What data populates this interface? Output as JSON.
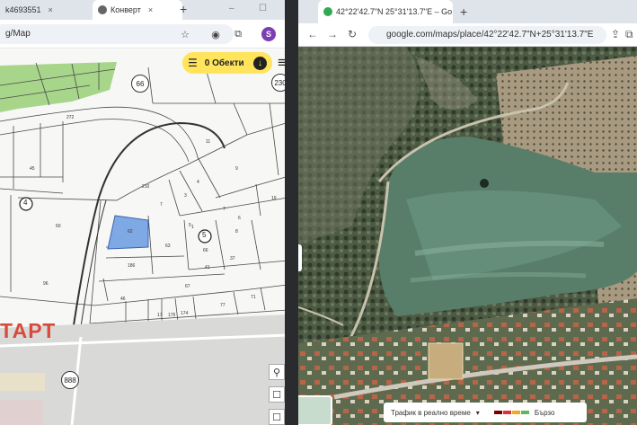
{
  "left_window": {
    "tabs": [
      {
        "label": "k4693551",
        "close": "×"
      },
      {
        "label": "Конверт",
        "close": "×"
      }
    ],
    "new_tab": "+",
    "window_controls": [
      "–",
      "☐"
    ],
    "address": "g/Map",
    "toolbar_icons": [
      "star-icon",
      "shield-icon",
      "extension-icon",
      "profile-avatar",
      "menu-icon"
    ],
    "profile_letter": "S",
    "objects_button_label": "0 Обекти",
    "map_labels": {
      "start_partial": "ТАРТ",
      "road_badges": [
        "66",
        "230",
        "888"
      ],
      "circled_parcels": [
        "4",
        "5"
      ],
      "parcel_numbers": [
        "272",
        "45",
        "210",
        "7",
        "3",
        "4",
        "19",
        "60",
        "62",
        "63",
        "5",
        "66",
        "37",
        "17",
        "67",
        "186",
        "46",
        "96",
        "71",
        "77",
        "174",
        "176",
        "7",
        "6",
        "8",
        "1",
        "41",
        "9",
        "11"
      ]
    }
  },
  "right_window": {
    "tab": {
      "label": "42°22'42.7\"N 25°31'13.7\"E – Go",
      "close": "×"
    },
    "new_tab": "+",
    "nav": {
      "back": "←",
      "forward": "→",
      "reload": "↻"
    },
    "address": "google.com/maps/place/42°22'42.7\"N+25°31'13.7\"E",
    "traffic": {
      "label": "Трафик в реално време",
      "fast_label": "Бързо",
      "colors": [
        "#7a0000",
        "#d33",
        "#f5a623",
        "#5cb85c"
      ]
    }
  },
  "colors": {
    "accent_yellow": "#ffe45c",
    "selected_parcel": "#7fa9e4",
    "green_zone": "#a7d58a"
  }
}
